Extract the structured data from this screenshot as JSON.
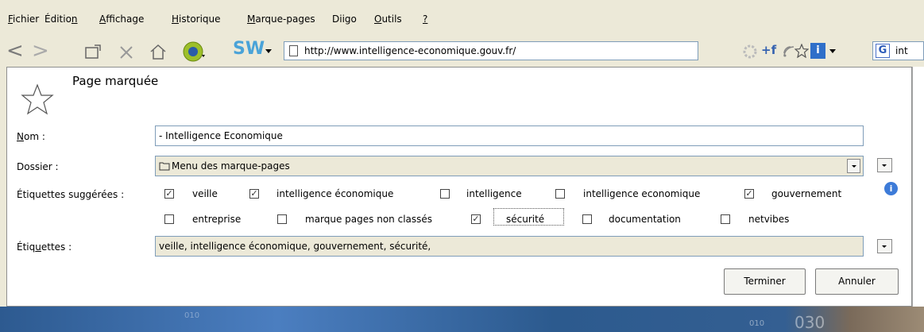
{
  "menu": {
    "items": [
      {
        "pre": "",
        "u": "F",
        "post": "ichier"
      },
      {
        "pre": "Éditio",
        "u": "n",
        "post": ""
      },
      {
        "pre": "",
        "u": "A",
        "post": "ffichage"
      },
      {
        "pre": "",
        "u": "H",
        "post": "istorique"
      },
      {
        "pre": "",
        "u": "M",
        "post": "arque-pages"
      },
      {
        "pre": "Diigo",
        "u": "",
        "post": ""
      },
      {
        "pre": "",
        "u": "O",
        "post": "utils"
      },
      {
        "pre": "",
        "u": "?",
        "post": ""
      }
    ]
  },
  "toolbar": {
    "url": "http://www.intelligence-economique.gouv.fr/",
    "sw_label": "SW",
    "search_fragment": "int"
  },
  "dialog": {
    "title": "Page marquée",
    "name_label": {
      "u": "N",
      "rest": "om :"
    },
    "name_value": "- Intelligence Economique",
    "folder_label": "Dossier :",
    "folder_value": "Menu des marque-pages",
    "suggested_label": "Étiquettes suggérées :",
    "tags_label": {
      "pre": "Étiq",
      "u": "u",
      "post": "ettes :"
    },
    "tags_value": "veille, intelligence économique, gouvernement, sécurité,",
    "suggested_tags": [
      {
        "label": "veille",
        "checked": true
      },
      {
        "label": "intelligence économique",
        "checked": true
      },
      {
        "label": "intelligence",
        "checked": false
      },
      {
        "label": "intelligence economique",
        "checked": false
      },
      {
        "label": "gouvernement",
        "checked": true
      },
      {
        "label": "entreprise",
        "checked": false
      },
      {
        "label": "marque pages non classés",
        "checked": false
      },
      {
        "label": "sécurité",
        "checked": true
      },
      {
        "label": "documentation",
        "checked": false
      },
      {
        "label": "netvibes",
        "checked": false
      }
    ],
    "done_button": "Terminer",
    "cancel_button": "Annuler"
  },
  "background": {
    "numbers": [
      "010",
      "010",
      "030"
    ]
  },
  "colors": {
    "accent": "#3d7bd8",
    "dialog_bg": "#ffffff",
    "chrome_bg": "#ece9d8"
  }
}
